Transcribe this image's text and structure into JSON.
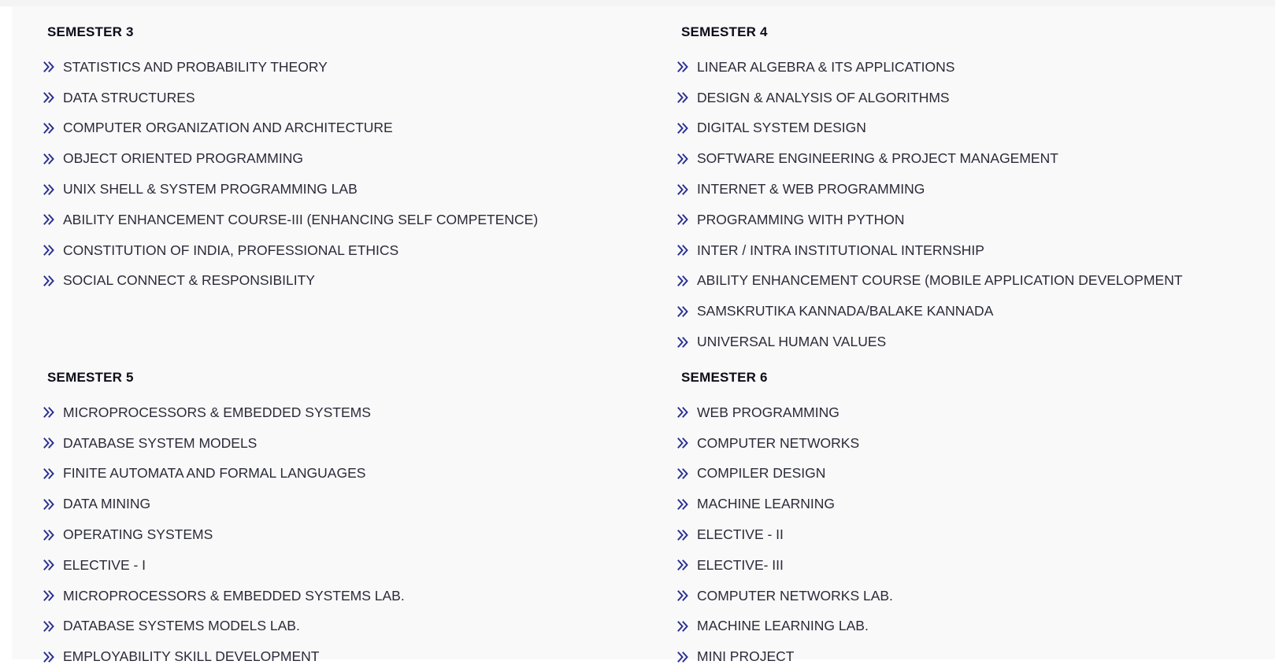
{
  "colors": {
    "accent_icon": "#2a3090",
    "text": "#2b2b3a",
    "heading": "#0d0d1a",
    "panel_bg": "#f9f9f9"
  },
  "icon": "double-chevron-right-icon",
  "semesters": [
    {
      "title": "SEMESTER 3",
      "courses": [
        "STATISTICS AND PROBABILITY THEORY",
        "DATA STRUCTURES",
        "COMPUTER ORGANIZATION AND ARCHITECTURE",
        "OBJECT ORIENTED PROGRAMMING",
        "UNIX SHELL & SYSTEM PROGRAMMING LAB",
        "ABILITY ENHANCEMENT COURSE-III (ENHANCING SELF COMPETENCE)",
        "CONSTITUTION OF INDIA, PROFESSIONAL ETHICS",
        "SOCIAL CONNECT & RESPONSIBILITY"
      ]
    },
    {
      "title": "SEMESTER 4",
      "courses": [
        "LINEAR ALGEBRA & ITS APPLICATIONS",
        "DESIGN & ANALYSIS OF ALGORITHMS",
        "DIGITAL SYSTEM DESIGN",
        "SOFTWARE ENGINEERING & PROJECT MANAGEMENT",
        "INTERNET & WEB PROGRAMMING",
        "PROGRAMMING WITH PYTHON",
        "INTER / INTRA INSTITUTIONAL INTERNSHIP",
        "ABILITY ENHANCEMENT COURSE (MOBILE APPLICATION DEVELOPMENT",
        "SAMSKRUTIKA KANNADA/BALAKE KANNADA",
        "UNIVERSAL HUMAN VALUES"
      ]
    },
    {
      "title": "SEMESTER 5",
      "courses": [
        "MICROPROCESSORS & EMBEDDED SYSTEMS",
        "DATABASE SYSTEM MODELS",
        "FINITE AUTOMATA AND FORMAL LANGUAGES",
        "DATA MINING",
        "OPERATING SYSTEMS",
        "ELECTIVE - I",
        "MICROPROCESSORS & EMBEDDED SYSTEMS LAB.",
        "DATABASE SYSTEMS MODELS LAB.",
        "EMPLOYABILITY SKILL DEVELOPMENT"
      ]
    },
    {
      "title": "SEMESTER 6",
      "courses": [
        "WEB PROGRAMMING",
        "COMPUTER NETWORKS",
        "COMPILER DESIGN",
        "MACHINE LEARNING",
        "ELECTIVE - II",
        "ELECTIVE- III",
        "COMPUTER NETWORKS LAB.",
        "MACHINE LEARNING LAB.",
        "MINI PROJECT"
      ]
    }
  ]
}
